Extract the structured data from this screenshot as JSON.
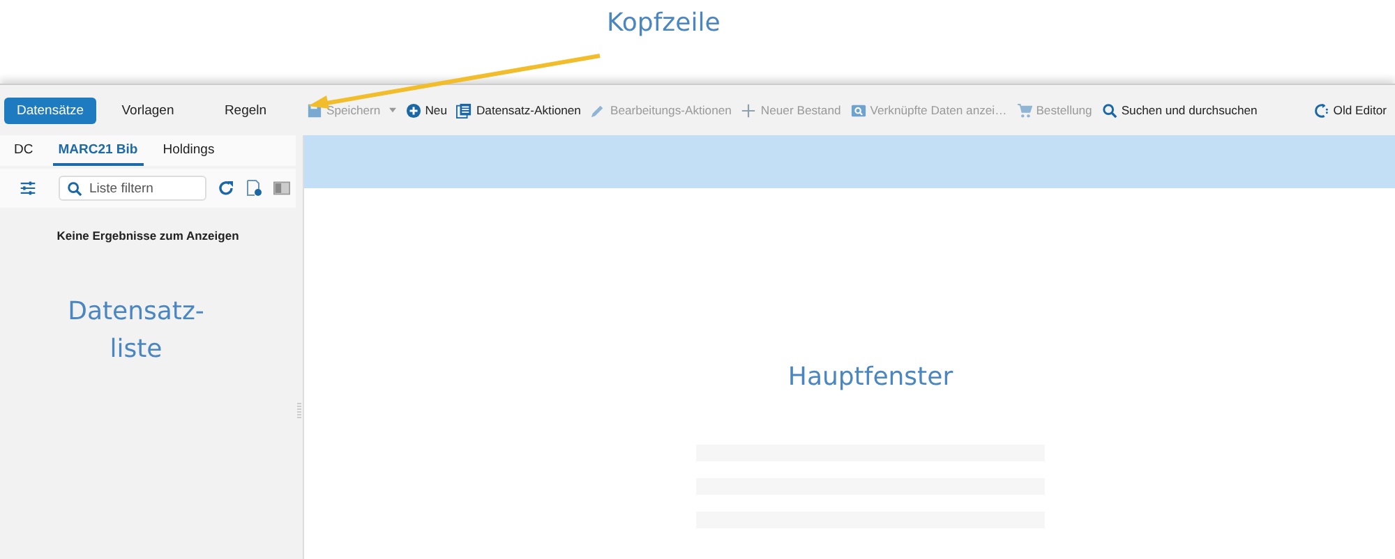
{
  "annotations": {
    "header": "Kopfzeile",
    "record_list": [
      "Datensatz-",
      "liste"
    ],
    "main_window": "Hauptfenster"
  },
  "left_tabs": [
    {
      "label": "Datensätze",
      "selected": true
    },
    {
      "label": "Vorlagen",
      "selected": false
    },
    {
      "label": "Regeln",
      "selected": false
    }
  ],
  "format_tabs": [
    {
      "label": "DC",
      "selected": false
    },
    {
      "label": "MARC21 Bib",
      "selected": true
    },
    {
      "label": "Holdings",
      "selected": false
    }
  ],
  "filter": {
    "placeholder": "Liste filtern"
  },
  "empty_message": "Keine Ergebnisse zum Anzeigen",
  "toolbar": [
    {
      "kind": "save",
      "label": "Speichern",
      "disabled": true,
      "dropdown": true
    },
    {
      "kind": "add",
      "label": "Neu",
      "disabled": false,
      "dropdown": false
    },
    {
      "kind": "list",
      "label": "Datensatz-Aktionen",
      "disabled": false,
      "dropdown": false
    },
    {
      "kind": "edit",
      "label": "Bearbeitungs-Aktionen",
      "disabled": true,
      "dropdown": false
    },
    {
      "kind": "plus",
      "label": "Neuer Bestand",
      "disabled": true,
      "dropdown": false
    },
    {
      "kind": "link",
      "label": "Verknüpfte Daten anzei…",
      "disabled": true,
      "dropdown": false
    },
    {
      "kind": "cart",
      "label": "Bestellung",
      "disabled": true,
      "dropdown": false
    },
    {
      "kind": "search",
      "label": "Suchen und durchsuchen",
      "disabled": false,
      "dropdown": false
    },
    {
      "kind": "refresh",
      "label": "Old Editor",
      "disabled": false,
      "dropdown": false
    }
  ]
}
